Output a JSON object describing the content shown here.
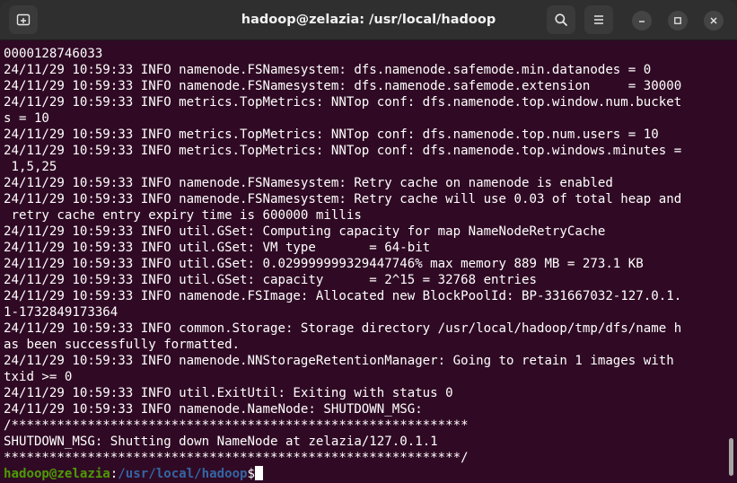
{
  "window": {
    "title": "hadoop@zelazia: /usr/local/hadoop"
  },
  "titlebar": {
    "new_tab_icon": "new-tab-icon",
    "search_icon": "search-icon",
    "menu_icon": "hamburger-menu-icon",
    "minimize_icon": "minimize-icon",
    "maximize_icon": "maximize-icon",
    "close_icon": "close-icon"
  },
  "terminal": {
    "colors": {
      "background": "#300a24",
      "foreground": "#ffffff",
      "prompt_user": "#4e9a06",
      "prompt_path": "#3465a4"
    },
    "lines": [
      "0000128746033",
      "24/11/29 10:59:33 INFO namenode.FSNamesystem: dfs.namenode.safemode.min.datanodes = 0",
      "24/11/29 10:59:33 INFO namenode.FSNamesystem: dfs.namenode.safemode.extension     = 30000",
      "24/11/29 10:59:33 INFO metrics.TopMetrics: NNTop conf: dfs.namenode.top.window.num.bucket",
      "s = 10",
      "24/11/29 10:59:33 INFO metrics.TopMetrics: NNTop conf: dfs.namenode.top.num.users = 10",
      "24/11/29 10:59:33 INFO metrics.TopMetrics: NNTop conf: dfs.namenode.top.windows.minutes =",
      " 1,5,25",
      "24/11/29 10:59:33 INFO namenode.FSNamesystem: Retry cache on namenode is enabled",
      "24/11/29 10:59:33 INFO namenode.FSNamesystem: Retry cache will use 0.03 of total heap and",
      " retry cache entry expiry time is 600000 millis",
      "24/11/29 10:59:33 INFO util.GSet: Computing capacity for map NameNodeRetryCache",
      "24/11/29 10:59:33 INFO util.GSet: VM type       = 64-bit",
      "24/11/29 10:59:33 INFO util.GSet: 0.029999999329447746% max memory 889 MB = 273.1 KB",
      "24/11/29 10:59:33 INFO util.GSet: capacity      = 2^15 = 32768 entries",
      "24/11/29 10:59:33 INFO namenode.FSImage: Allocated new BlockPoolId: BP-331667032-127.0.1.",
      "1-1732849173364",
      "24/11/29 10:59:33 INFO common.Storage: Storage directory /usr/local/hadoop/tmp/dfs/name h",
      "as been successfully formatted.",
      "24/11/29 10:59:33 INFO namenode.NNStorageRetentionManager: Going to retain 1 images with",
      "txid >= 0",
      "24/11/29 10:59:33 INFO util.ExitUtil: Exiting with status 0",
      "24/11/29 10:59:33 INFO namenode.NameNode: SHUTDOWN_MSG:",
      "/************************************************************",
      "SHUTDOWN_MSG: Shutting down NameNode at zelazia/127.0.1.1",
      "************************************************************/"
    ],
    "prompt": {
      "user_host": "hadoop@zelazia",
      "colon": ":",
      "path": "/usr/local/hadoop",
      "symbol": "$"
    }
  }
}
